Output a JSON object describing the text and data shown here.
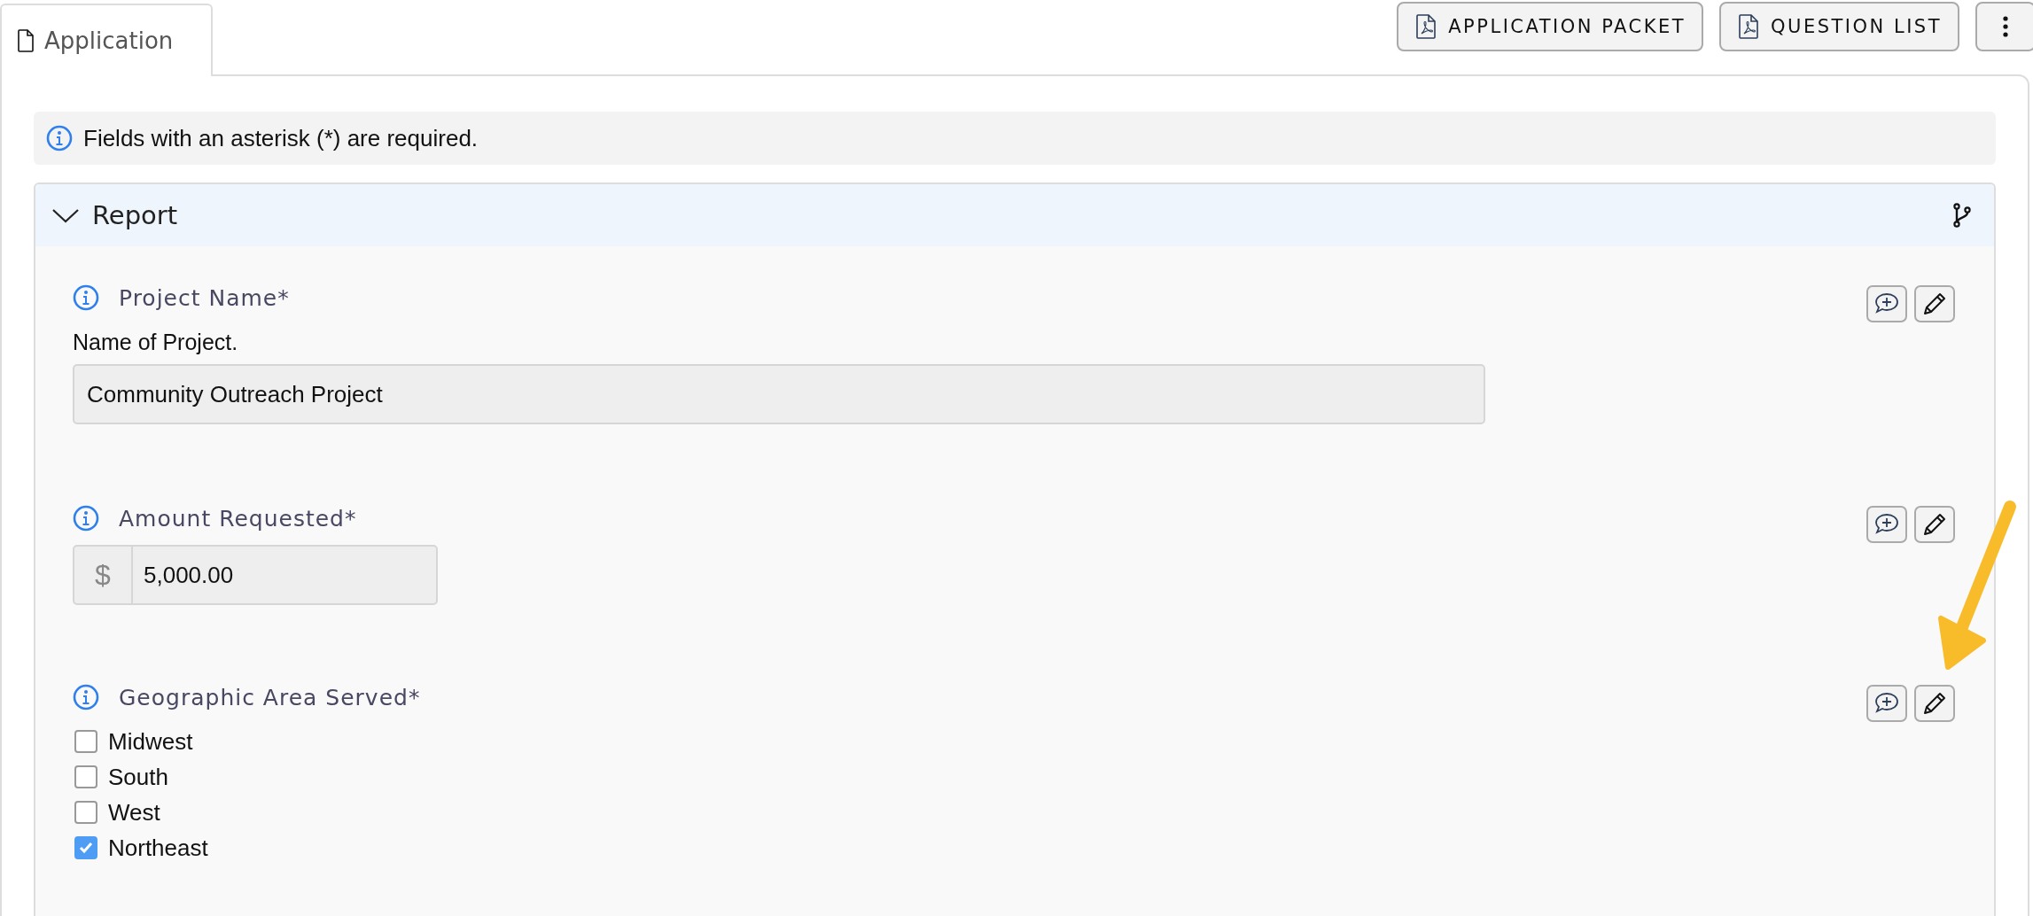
{
  "tabs": [
    {
      "label": "Application",
      "selected": true
    }
  ],
  "toolbar": {
    "buttons": [
      {
        "label": "APPLICATION PACKET"
      },
      {
        "label": "QUESTION LIST"
      }
    ]
  },
  "notice": {
    "text": "Fields with an asterisk (*) are required."
  },
  "section": {
    "title": "Report",
    "expanded": true,
    "questions": [
      {
        "kind": "text",
        "label": "Project Name*",
        "description": "Name of Project.",
        "value": "Community Outreach Project"
      },
      {
        "kind": "currency",
        "label": "Amount Requested*",
        "prefix": "$",
        "value": "5,000.00"
      },
      {
        "kind": "checkboxes",
        "label": "Geographic Area Served*",
        "options": [
          {
            "label": "Midwest",
            "checked": false
          },
          {
            "label": "South",
            "checked": false
          },
          {
            "label": "West",
            "checked": false
          },
          {
            "label": "Northeast",
            "checked": true
          }
        ]
      }
    ]
  }
}
